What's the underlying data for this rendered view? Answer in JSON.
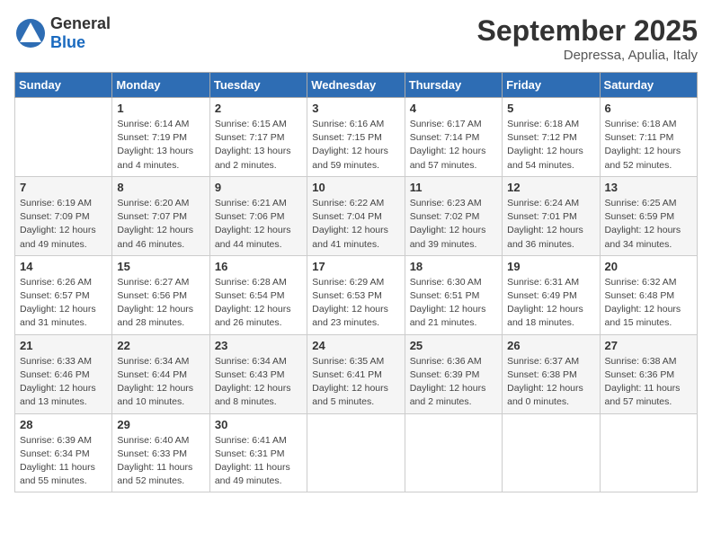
{
  "header": {
    "logo_general": "General",
    "logo_blue": "Blue",
    "month_title": "September 2025",
    "location": "Depressa, Apulia, Italy"
  },
  "days_of_week": [
    "Sunday",
    "Monday",
    "Tuesday",
    "Wednesday",
    "Thursday",
    "Friday",
    "Saturday"
  ],
  "weeks": [
    [
      {
        "num": "",
        "info": ""
      },
      {
        "num": "1",
        "info": "Sunrise: 6:14 AM\nSunset: 7:19 PM\nDaylight: 13 hours\nand 4 minutes."
      },
      {
        "num": "2",
        "info": "Sunrise: 6:15 AM\nSunset: 7:17 PM\nDaylight: 13 hours\nand 2 minutes."
      },
      {
        "num": "3",
        "info": "Sunrise: 6:16 AM\nSunset: 7:15 PM\nDaylight: 12 hours\nand 59 minutes."
      },
      {
        "num": "4",
        "info": "Sunrise: 6:17 AM\nSunset: 7:14 PM\nDaylight: 12 hours\nand 57 minutes."
      },
      {
        "num": "5",
        "info": "Sunrise: 6:18 AM\nSunset: 7:12 PM\nDaylight: 12 hours\nand 54 minutes."
      },
      {
        "num": "6",
        "info": "Sunrise: 6:18 AM\nSunset: 7:11 PM\nDaylight: 12 hours\nand 52 minutes."
      }
    ],
    [
      {
        "num": "7",
        "info": "Sunrise: 6:19 AM\nSunset: 7:09 PM\nDaylight: 12 hours\nand 49 minutes."
      },
      {
        "num": "8",
        "info": "Sunrise: 6:20 AM\nSunset: 7:07 PM\nDaylight: 12 hours\nand 46 minutes."
      },
      {
        "num": "9",
        "info": "Sunrise: 6:21 AM\nSunset: 7:06 PM\nDaylight: 12 hours\nand 44 minutes."
      },
      {
        "num": "10",
        "info": "Sunrise: 6:22 AM\nSunset: 7:04 PM\nDaylight: 12 hours\nand 41 minutes."
      },
      {
        "num": "11",
        "info": "Sunrise: 6:23 AM\nSunset: 7:02 PM\nDaylight: 12 hours\nand 39 minutes."
      },
      {
        "num": "12",
        "info": "Sunrise: 6:24 AM\nSunset: 7:01 PM\nDaylight: 12 hours\nand 36 minutes."
      },
      {
        "num": "13",
        "info": "Sunrise: 6:25 AM\nSunset: 6:59 PM\nDaylight: 12 hours\nand 34 minutes."
      }
    ],
    [
      {
        "num": "14",
        "info": "Sunrise: 6:26 AM\nSunset: 6:57 PM\nDaylight: 12 hours\nand 31 minutes."
      },
      {
        "num": "15",
        "info": "Sunrise: 6:27 AM\nSunset: 6:56 PM\nDaylight: 12 hours\nand 28 minutes."
      },
      {
        "num": "16",
        "info": "Sunrise: 6:28 AM\nSunset: 6:54 PM\nDaylight: 12 hours\nand 26 minutes."
      },
      {
        "num": "17",
        "info": "Sunrise: 6:29 AM\nSunset: 6:53 PM\nDaylight: 12 hours\nand 23 minutes."
      },
      {
        "num": "18",
        "info": "Sunrise: 6:30 AM\nSunset: 6:51 PM\nDaylight: 12 hours\nand 21 minutes."
      },
      {
        "num": "19",
        "info": "Sunrise: 6:31 AM\nSunset: 6:49 PM\nDaylight: 12 hours\nand 18 minutes."
      },
      {
        "num": "20",
        "info": "Sunrise: 6:32 AM\nSunset: 6:48 PM\nDaylight: 12 hours\nand 15 minutes."
      }
    ],
    [
      {
        "num": "21",
        "info": "Sunrise: 6:33 AM\nSunset: 6:46 PM\nDaylight: 12 hours\nand 13 minutes."
      },
      {
        "num": "22",
        "info": "Sunrise: 6:34 AM\nSunset: 6:44 PM\nDaylight: 12 hours\nand 10 minutes."
      },
      {
        "num": "23",
        "info": "Sunrise: 6:34 AM\nSunset: 6:43 PM\nDaylight: 12 hours\nand 8 minutes."
      },
      {
        "num": "24",
        "info": "Sunrise: 6:35 AM\nSunset: 6:41 PM\nDaylight: 12 hours\nand 5 minutes."
      },
      {
        "num": "25",
        "info": "Sunrise: 6:36 AM\nSunset: 6:39 PM\nDaylight: 12 hours\nand 2 minutes."
      },
      {
        "num": "26",
        "info": "Sunrise: 6:37 AM\nSunset: 6:38 PM\nDaylight: 12 hours\nand 0 minutes."
      },
      {
        "num": "27",
        "info": "Sunrise: 6:38 AM\nSunset: 6:36 PM\nDaylight: 11 hours\nand 57 minutes."
      }
    ],
    [
      {
        "num": "28",
        "info": "Sunrise: 6:39 AM\nSunset: 6:34 PM\nDaylight: 11 hours\nand 55 minutes."
      },
      {
        "num": "29",
        "info": "Sunrise: 6:40 AM\nSunset: 6:33 PM\nDaylight: 11 hours\nand 52 minutes."
      },
      {
        "num": "30",
        "info": "Sunrise: 6:41 AM\nSunset: 6:31 PM\nDaylight: 11 hours\nand 49 minutes."
      },
      {
        "num": "",
        "info": ""
      },
      {
        "num": "",
        "info": ""
      },
      {
        "num": "",
        "info": ""
      },
      {
        "num": "",
        "info": ""
      }
    ]
  ]
}
